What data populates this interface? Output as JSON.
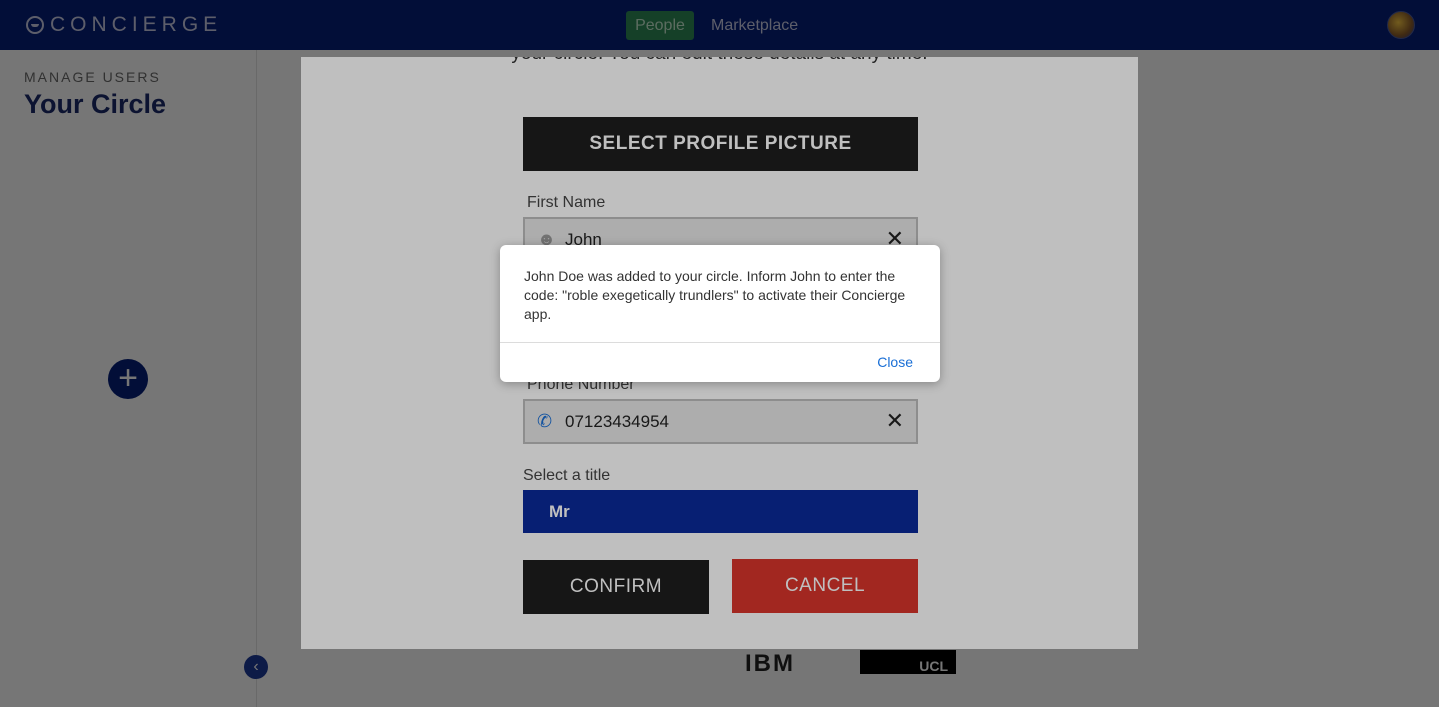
{
  "header": {
    "logo_text": "CONCIERGE",
    "nav_people": "People",
    "nav_marketplace": "Marketplace",
    "accent_color": "#06207a"
  },
  "sidebar": {
    "kicker": "MANAGE USERS",
    "title": "Your Circle",
    "add_icon": "+",
    "collapse_icon": "‹"
  },
  "partners": {
    "ibm": "IBM",
    "ucl": "UCL"
  },
  "modal": {
    "intro_text": "your circle. You can edit these details at any time.",
    "select_picture_label": "SELECT PROFILE PICTURE",
    "first_name_label": "First Name",
    "first_name_value": "John",
    "phone_label": "Phone Number",
    "phone_value": "07123434954",
    "title_label": "Select a title",
    "title_value": "Mr",
    "confirm_label": "CONFIRM",
    "cancel_label": "CANCEL"
  },
  "alert": {
    "message": "John Doe was added to your circle. Inform John to enter the code: \"roble exegetically trundlers\" to activate their Concierge app.",
    "close_label": "Close"
  }
}
